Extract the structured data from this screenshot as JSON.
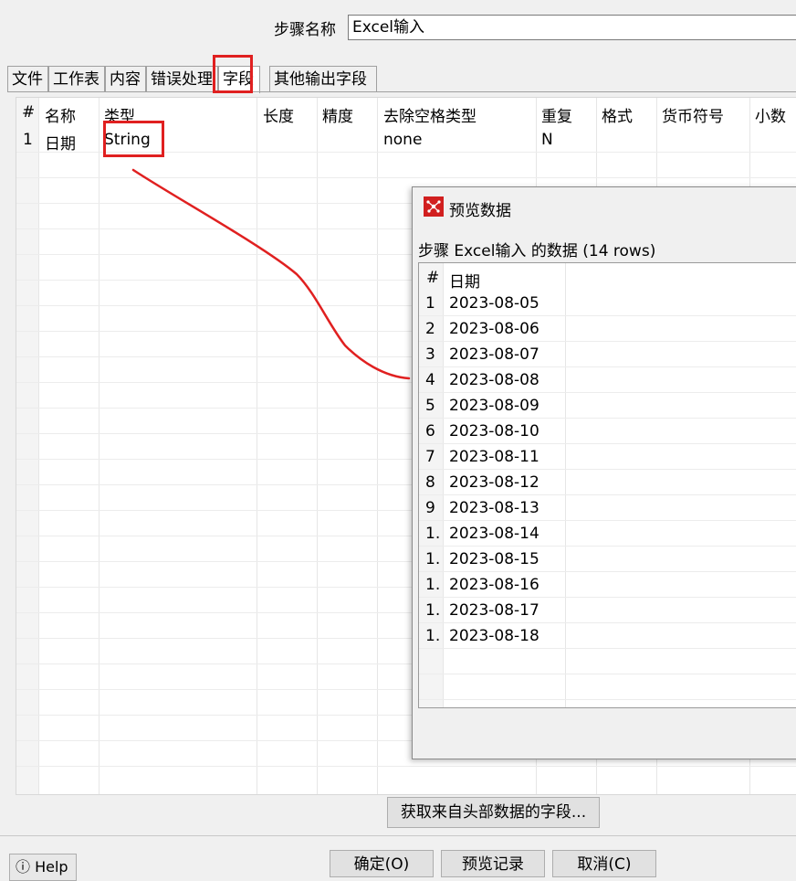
{
  "step": {
    "label": "步骤名称",
    "value": "Excel输入"
  },
  "tabs": [
    "文件",
    "工作表",
    "内容",
    "错误处理",
    "字段",
    "其他输出字段"
  ],
  "active_tab": "字段",
  "fields_table": {
    "columns": [
      "#",
      "名称",
      "类型",
      "长度",
      "精度",
      "去除空格类型",
      "重复",
      "格式",
      "货币符号",
      "小数"
    ],
    "rows": [
      {
        "num": "1",
        "name": "日期",
        "type": "String",
        "length": "",
        "precision": "",
        "trim": "none",
        "repeat": "N"
      }
    ]
  },
  "preview": {
    "title": "预览数据",
    "subtitle": "步骤 Excel输入 的数据  (14 rows)",
    "columns": [
      "#",
      "日期"
    ],
    "rows": [
      [
        "1",
        "2023-08-05"
      ],
      [
        "2",
        "2023-08-06"
      ],
      [
        "3",
        "2023-08-07"
      ],
      [
        "4",
        "2023-08-08"
      ],
      [
        "5",
        "2023-08-09"
      ],
      [
        "6",
        "2023-08-10"
      ],
      [
        "7",
        "2023-08-11"
      ],
      [
        "8",
        "2023-08-12"
      ],
      [
        "9",
        "2023-08-13"
      ],
      [
        "1.",
        "2023-08-14"
      ],
      [
        "1.",
        "2023-08-15"
      ],
      [
        "1.",
        "2023-08-16"
      ],
      [
        "1.",
        "2023-08-17"
      ],
      [
        "1.",
        "2023-08-18"
      ]
    ]
  },
  "buttons": {
    "get_fields": "获取来自头部数据的字段...",
    "ok": "确定(O)",
    "preview": "预览记录",
    "cancel": "取消(C)",
    "help": "Help"
  },
  "colors": {
    "annotation": "#e02020",
    "dialog_icon": "#d11f1f"
  }
}
